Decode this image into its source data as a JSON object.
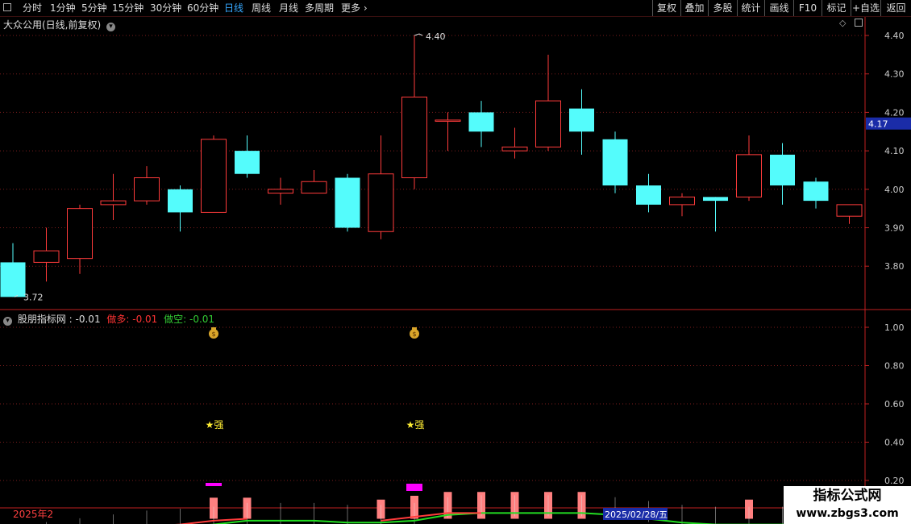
{
  "toolbar": {
    "periods": [
      "分时",
      "1分钟",
      "5分钟",
      "15分钟",
      "30分钟",
      "60分钟",
      "日线",
      "周线",
      "月线",
      "多周期",
      "更多"
    ],
    "active_period": "日线",
    "right_buttons": [
      "复权",
      "叠加",
      "多股",
      "统计",
      "画线",
      "F10",
      "标记",
      "+自选",
      "返回"
    ]
  },
  "main_panel": {
    "title": "大众公用(日线,前复权)",
    "price_labels": [
      "4.40",
      "4.30",
      "4.20",
      "4.10",
      "4.00",
      "3.90",
      "3.80"
    ],
    "current_price": "4.17",
    "current_price_color": "#1a2ca8",
    "high_label": "4.40",
    "low_label": "3.72"
  },
  "indicator_panel": {
    "name": "股朋指标网",
    "value": ": -0.01",
    "long_label": "做多: -0.01",
    "short_label": "做空: -0.01",
    "long_color": "#ff3333",
    "short_color": "#33cc33",
    "axis_labels": [
      "1.00",
      "0.80",
      "0.60",
      "0.40",
      "0.20"
    ],
    "strong_label": "★强",
    "money_icon": "money-bag-icon"
  },
  "date_bar": {
    "start_label": "2025年2",
    "cursor_date": "2025/02/28/五"
  },
  "colors": {
    "up": "#ff3b3b",
    "down": "#54fcfc",
    "grid": "#7a1c1c",
    "axis": "#c02020",
    "magenta": "#ff00ff",
    "pink_bar": "#ff8080",
    "green_line": "#22dd22"
  },
  "chart_data": {
    "type": "candlestick",
    "ylim": [
      3.7,
      4.45
    ],
    "candles": [
      {
        "o": 3.81,
        "h": 3.86,
        "l": 3.72,
        "c": 3.72
      },
      {
        "o": 3.81,
        "h": 3.9,
        "l": 3.76,
        "c": 3.84
      },
      {
        "o": 3.82,
        "h": 3.96,
        "l": 3.78,
        "c": 3.95
      },
      {
        "o": 3.96,
        "h": 4.04,
        "l": 3.92,
        "c": 3.97
      },
      {
        "o": 3.97,
        "h": 4.06,
        "l": 3.96,
        "c": 4.03
      },
      {
        "o": 4.0,
        "h": 4.01,
        "l": 3.89,
        "c": 3.94
      },
      {
        "o": 3.94,
        "h": 4.14,
        "l": 3.94,
        "c": 4.13
      },
      {
        "o": 4.1,
        "h": 4.14,
        "l": 4.03,
        "c": 4.04
      },
      {
        "o": 3.99,
        "h": 4.03,
        "l": 3.96,
        "c": 4.0
      },
      {
        "o": 3.99,
        "h": 4.05,
        "l": 3.99,
        "c": 4.02
      },
      {
        "o": 4.03,
        "h": 4.04,
        "l": 3.89,
        "c": 3.9
      },
      {
        "o": 3.89,
        "h": 4.14,
        "l": 3.87,
        "c": 4.04
      },
      {
        "o": 4.03,
        "h": 4.4,
        "l": 4.0,
        "c": 4.24
      },
      {
        "o": 4.18,
        "h": 4.2,
        "l": 4.1,
        "c": 4.18
      },
      {
        "o": 4.2,
        "h": 4.23,
        "l": 4.11,
        "c": 4.15
      },
      {
        "o": 4.1,
        "h": 4.16,
        "l": 4.08,
        "c": 4.11
      },
      {
        "o": 4.11,
        "h": 4.35,
        "l": 4.1,
        "c": 4.23
      },
      {
        "o": 4.21,
        "h": 4.26,
        "l": 4.09,
        "c": 4.15
      },
      {
        "o": 4.13,
        "h": 4.15,
        "l": 3.99,
        "c": 4.01
      },
      {
        "o": 4.01,
        "h": 4.04,
        "l": 3.94,
        "c": 3.96
      },
      {
        "o": 3.96,
        "h": 3.99,
        "l": 3.93,
        "c": 3.98
      },
      {
        "o": 3.98,
        "h": 3.98,
        "l": 3.89,
        "c": 3.97
      },
      {
        "o": 3.98,
        "h": 4.14,
        "l": 3.97,
        "c": 4.09
      },
      {
        "o": 4.09,
        "h": 4.12,
        "l": 3.96,
        "c": 4.01
      },
      {
        "o": 4.02,
        "h": 4.03,
        "l": 3.95,
        "c": 3.97
      },
      {
        "o": 3.93,
        "h": 3.96,
        "l": 3.91,
        "c": 3.96
      }
    ],
    "indicator": {
      "ylim": [
        -0.15,
        1.1
      ],
      "green_line": [
        -0.12,
        -0.11,
        -0.09,
        -0.07,
        -0.05,
        -0.04,
        -0.03,
        -0.01,
        -0.01,
        -0.01,
        -0.02,
        -0.02,
        -0.01,
        0.02,
        0.03,
        0.03,
        0.03,
        0.03,
        0.02,
        0.0,
        -0.02,
        -0.03,
        -0.03,
        -0.03,
        -0.04,
        -0.05
      ],
      "red_line": [
        -0.12,
        -0.1,
        -0.08,
        -0.06,
        -0.04,
        -0.03,
        -0.01,
        0.0,
        null,
        null,
        null,
        -0.01,
        0.01,
        0.03,
        0.03,
        null,
        null,
        null,
        null,
        null,
        null,
        null,
        null,
        null,
        null,
        null
      ],
      "pink_bars": [
        0,
        0,
        0,
        0,
        0,
        0,
        0.1,
        0.1,
        0,
        0,
        0,
        0.09,
        0.11,
        0.13,
        0.13,
        0.13,
        0.13,
        0.13,
        0,
        0,
        0,
        0,
        0.09,
        0,
        0,
        0
      ],
      "magenta_marks": [
        0,
        0,
        0,
        0,
        0,
        0,
        1,
        0,
        0,
        0,
        0,
        0,
        1,
        0,
        0,
        0,
        0,
        0,
        0,
        0,
        0,
        0,
        0,
        0,
        0,
        0
      ],
      "strong_at": [
        6,
        12
      ],
      "money_at": [
        6,
        12
      ]
    }
  }
}
